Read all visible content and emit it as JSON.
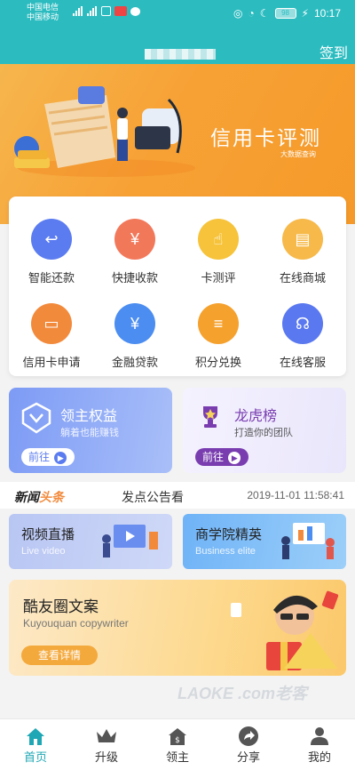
{
  "status_bar": {
    "carrier1": "中国电信",
    "carrier2": "中国移动",
    "battery": "98",
    "time": "10:17"
  },
  "header": {
    "sign_in": "签到"
  },
  "banner": {
    "title": "信用卡评测",
    "subtitle": "大数据查询"
  },
  "services": [
    {
      "label": "智能还款",
      "icon": "card-return-icon",
      "color": "#5b7cf0"
    },
    {
      "label": "快捷收款",
      "icon": "yen-circle-icon",
      "color": "#f2785a"
    },
    {
      "label": "卡测评",
      "icon": "hand-touch-icon",
      "color": "#f6c33a"
    },
    {
      "label": "在线商城",
      "icon": "shop-icon",
      "color": "#f6b94a"
    },
    {
      "label": "信用卡申请",
      "icon": "credit-card-icon",
      "color": "#f28a3c"
    },
    {
      "label": "金融贷款",
      "icon": "money-bag-icon",
      "color": "#4b8df0"
    },
    {
      "label": "积分兑换",
      "icon": "coins-icon",
      "color": "#f5a12e"
    },
    {
      "label": "在线客服",
      "icon": "headset-icon",
      "color": "#5a78ef"
    }
  ],
  "promos": {
    "left": {
      "title": "领主权益",
      "subtitle": "躺着也能赚钱",
      "button": "前往"
    },
    "right": {
      "title": "龙虎榜",
      "subtitle": "打造你的团队",
      "button": "前往"
    }
  },
  "news": {
    "logo_a": "新闻",
    "logo_b": "头条",
    "text": "发点公告看",
    "time": "2019-11-01 11:58:41"
  },
  "cards": {
    "video": {
      "title": "视频直播",
      "subtitle": "Live video"
    },
    "business": {
      "title": "商学院精英",
      "subtitle": "Business elite"
    }
  },
  "copywriter": {
    "title": "酷友圈文案",
    "subtitle": "Kuyouquan copywriter",
    "button": "查看详情"
  },
  "watermark": "LAOKE .com老客",
  "tabs": [
    {
      "label": "首页",
      "icon": "home-icon"
    },
    {
      "label": "升级",
      "icon": "crown-icon"
    },
    {
      "label": "领主",
      "icon": "moneybag-house-icon"
    },
    {
      "label": "分享",
      "icon": "share-icon"
    },
    {
      "label": "我的",
      "icon": "user-icon"
    }
  ],
  "colors": {
    "teal": "#2cbcc0",
    "banner_orange": "#f7a135",
    "active_tab": "#1fa7b5"
  }
}
